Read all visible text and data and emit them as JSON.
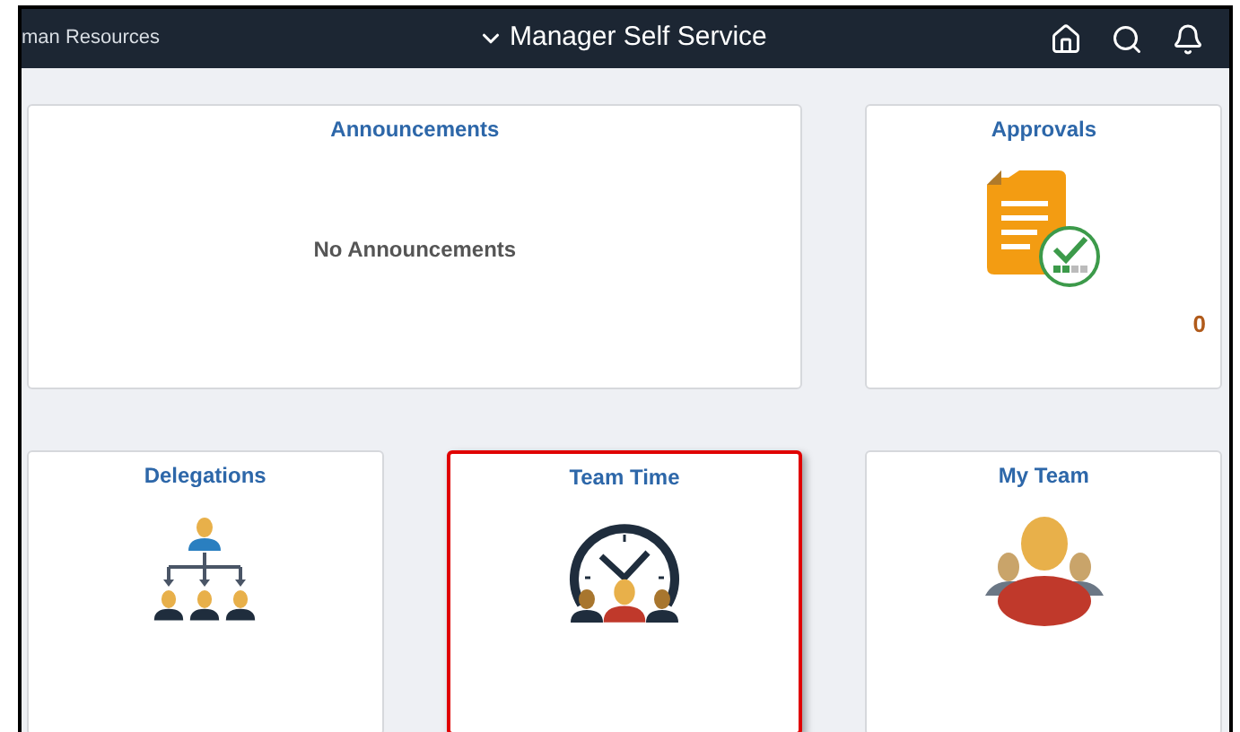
{
  "header": {
    "breadcrumb": "man Resources",
    "title": "Manager Self Service"
  },
  "tiles": [
    {
      "title": "Announcements",
      "kind": "message",
      "message": "No Announcements",
      "highlighted": false
    },
    {
      "title": "Approvals",
      "kind": "approvals",
      "count": "0",
      "highlighted": false
    },
    {
      "title": "Delegations",
      "kind": "delegations",
      "highlighted": false
    },
    {
      "title": "Team Time",
      "kind": "team-time",
      "highlighted": true
    },
    {
      "title": "My Team",
      "kind": "my-team",
      "highlighted": false
    }
  ]
}
